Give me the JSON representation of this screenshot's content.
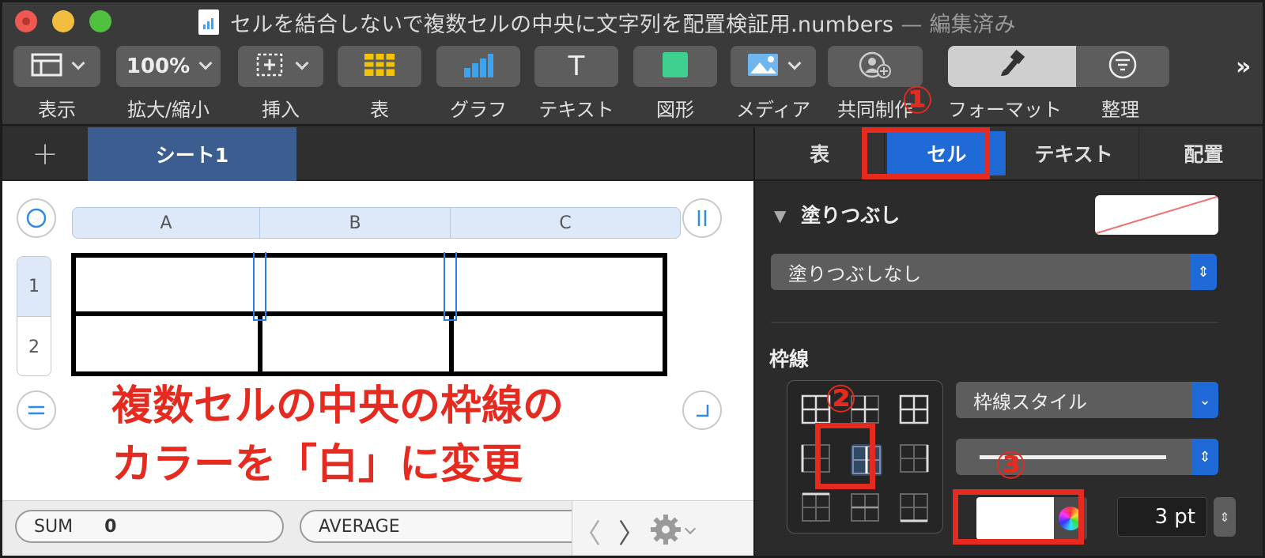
{
  "window": {
    "title": "セルを結合しないで複数セルの中央に文字列を配置検証用.numbers",
    "title_suffix": "— 編集済み"
  },
  "toolbar": {
    "view_label": "表示",
    "zoom_value": "100%",
    "zoom_label": "拡大/縮小",
    "insert_label": "挿入",
    "table_label": "表",
    "chart_label": "グラフ",
    "text_label": "テキスト",
    "text_glyph": "T",
    "shape_label": "図形",
    "media_label": "メディア",
    "collab_label": "共同制作",
    "format_label": "フォーマット",
    "organize_label": "整理",
    "more_glyph": "»"
  },
  "sheets": {
    "add_glyph": "+",
    "tabs": [
      "シート1"
    ]
  },
  "table": {
    "columns": [
      "A",
      "B",
      "C"
    ],
    "rows": [
      "1",
      "2"
    ]
  },
  "annotation": {
    "line1": "複数セルの中央の枠線の",
    "line2": "カラーを「白」に変更",
    "step1": "①",
    "step2": "②",
    "step3": "③"
  },
  "statusbar": {
    "sum_label": "SUM",
    "sum_value": "0",
    "average_label": "AVERAGE",
    "prev_glyph": "〈",
    "next_glyph": "〉"
  },
  "inspector": {
    "tabs": [
      "表",
      "セル",
      "テキスト",
      "配置"
    ],
    "selected_tab": "セル",
    "fill_section": "塗りつぶし",
    "fill_value": "塗りつぶしなし",
    "border_section": "枠線",
    "border_style": "枠線スタイル",
    "border_width": "3 pt",
    "border_color": "#ffffff"
  },
  "colors": {
    "accent": "#1f6ad6",
    "annotation_red": "#e52b20"
  }
}
